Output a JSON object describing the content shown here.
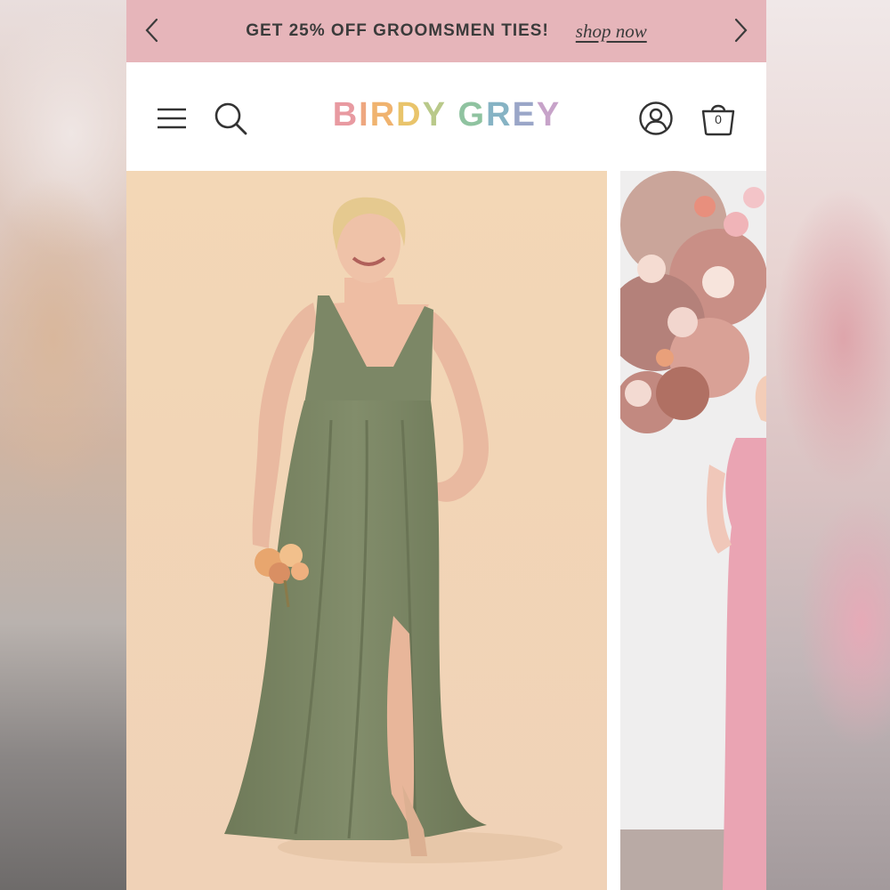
{
  "promo": {
    "text": "GET 25% OFF GROOMSMEN TIES!",
    "link": "shop now",
    "background": "#e6b5ba"
  },
  "header": {
    "logo": {
      "letters": [
        {
          "char": "B",
          "color": "#e89aa1"
        },
        {
          "char": "I",
          "color": "#eea77f"
        },
        {
          "char": "R",
          "color": "#f0b36f"
        },
        {
          "char": "D",
          "color": "#e9c46b"
        },
        {
          "char": "Y",
          "color": "#b9c98a"
        },
        {
          "char": " ",
          "color": "#ffffff"
        },
        {
          "char": "G",
          "color": "#8fc3a0"
        },
        {
          "char": "R",
          "color": "#86b3c4"
        },
        {
          "char": "E",
          "color": "#9aa6c8"
        },
        {
          "char": "Y",
          "color": "#c7a3c9"
        }
      ]
    },
    "icons": {
      "menu": "hamburger-menu-icon",
      "search": "search-icon",
      "account": "user-icon",
      "bag": "shopping-bag-icon"
    },
    "bag_count": "0"
  },
  "products": {
    "main": {
      "dress_color": "#7f8a68",
      "background": "#f1d6b8"
    },
    "second": {
      "dress_color": "#eaa4b3",
      "background": "#efeeee"
    }
  }
}
